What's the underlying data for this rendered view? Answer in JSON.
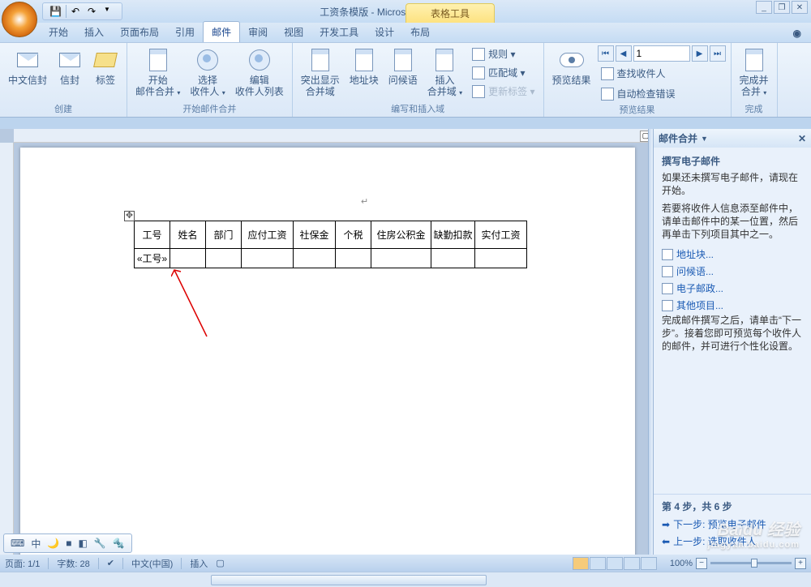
{
  "title": "工资条模版 - Microsoft Word",
  "context_tab": "表格工具",
  "qat": {
    "save": "save-icon",
    "undo": "undo-icon",
    "redo": "redo-icon"
  },
  "tabs": [
    "开始",
    "插入",
    "页面布局",
    "引用",
    "邮件",
    "审阅",
    "视图",
    "开发工具"
  ],
  "context_tabs": [
    "设计",
    "布局"
  ],
  "active_tab": "邮件",
  "ribbon": {
    "groups": [
      {
        "label": "创建",
        "items": [
          {
            "id": "cn-envelope",
            "label": "中文信封"
          },
          {
            "id": "envelope",
            "label": "信封"
          },
          {
            "id": "labels",
            "label": "标签"
          }
        ]
      },
      {
        "label": "开始邮件合并",
        "items": [
          {
            "id": "start-merge",
            "label": "开始\n邮件合并",
            "dd": true
          },
          {
            "id": "select-recipients",
            "label": "选择\n收件人",
            "dd": true
          },
          {
            "id": "edit-recipients",
            "label": "编辑\n收件人列表"
          }
        ]
      },
      {
        "label": "编写和插入域",
        "items": [
          {
            "id": "highlight-fields",
            "label": "突出显示\n合并域"
          },
          {
            "id": "address-block",
            "label": "地址块"
          },
          {
            "id": "greeting",
            "label": "问候语"
          },
          {
            "id": "insert-field",
            "label": "插入\n合并域",
            "dd": true
          }
        ],
        "side": [
          {
            "id": "rules",
            "label": "规则"
          },
          {
            "id": "match",
            "label": "匹配域"
          },
          {
            "id": "update-labels",
            "label": "更新标签",
            "disabled": true
          }
        ]
      },
      {
        "label": "预览结果",
        "items": [
          {
            "id": "preview",
            "label": "预览结果"
          }
        ],
        "nav": {
          "value": "1",
          "side": [
            {
              "id": "find-recipient",
              "label": "查找收件人"
            },
            {
              "id": "auto-check",
              "label": "自动检查错误"
            }
          ]
        }
      },
      {
        "label": "完成",
        "items": [
          {
            "id": "finish",
            "label": "完成并\n合并",
            "dd": true
          }
        ]
      }
    ]
  },
  "table": {
    "headers": [
      "工号",
      "姓名",
      "部门",
      "应付工资",
      "社保金",
      "个税",
      "住房公积金",
      "缺勤扣款",
      "实付工资"
    ],
    "row2": [
      "«工号»",
      "",
      "",
      "",
      "",
      "",
      "",
      "",
      ""
    ]
  },
  "taskpane": {
    "title": "邮件合并",
    "section": "撰写电子邮件",
    "p1": "如果还未撰写电子邮件，请现在开始。",
    "p2": "若要将收件人信息添至邮件中，请单击邮件中的某一位置，然后再单击下列项目其中之一。",
    "links": [
      {
        "id": "address-block",
        "label": "地址块..."
      },
      {
        "id": "greeting",
        "label": "问候语..."
      },
      {
        "id": "e-postage",
        "label": "电子邮政..."
      },
      {
        "id": "more-items",
        "label": "其他项目..."
      }
    ],
    "p3": "完成邮件撰写之后，请单击“下一步”。接着您即可预览每个收件人的邮件，并可进行个性化设置。",
    "step": "第 4 步，共 6 步",
    "next": "下一步: 预览电子邮件",
    "prev": "上一步: 选取收件人"
  },
  "status": {
    "page": "页面: 1/1",
    "words": "字数: 28",
    "lang": "中文(中国)",
    "mode": "插入",
    "zoom": "100%"
  },
  "ime": [
    "中",
    "🌙",
    "■",
    "◧",
    "🔧",
    "🔩"
  ],
  "watermark": {
    "brand": "Baidu 经验",
    "url": "jingyan.baidu.com"
  }
}
